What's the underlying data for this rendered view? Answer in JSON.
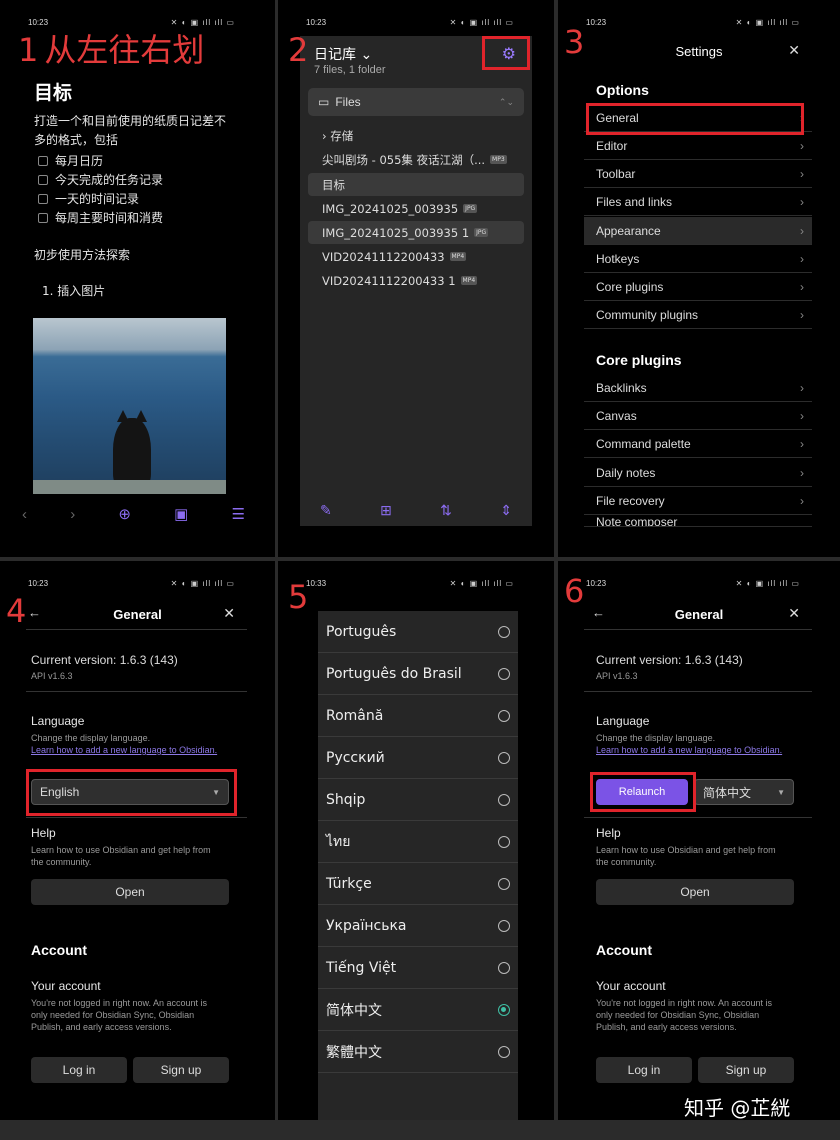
{
  "steps": [
    "1",
    "2",
    "3",
    "4",
    "5",
    "6"
  ],
  "step1_caption": "从左往右划",
  "status": {
    "time_a": "10:23",
    "time_b": "10:33",
    "icons": "✕ ◐ ▣ ıll ıll ▭"
  },
  "panel1": {
    "title": "目标",
    "intro": "打造一个和目前使用的纸质日记差不多的格式，包括",
    "checklist": [
      "每月日历",
      "今天完成的任务记录",
      "一天的时间记录",
      "每周主要时间和消费"
    ],
    "section": "初步使用方法探索",
    "list_item": "1. 插入图片",
    "toolbar": [
      "‹",
      "›",
      "⊕",
      "▣",
      "☰"
    ]
  },
  "panel2": {
    "vault_name": "日记库 ⌄",
    "vault_summary": "7 files, 1 folder",
    "files_label": "Files",
    "rows": [
      {
        "text": "› 存储",
        "tag": ""
      },
      {
        "text": "尖叫剧场 - 055集 夜话江湖（...",
        "tag": "MP3"
      },
      {
        "text": "目标",
        "tag": ""
      },
      {
        "text": "IMG_20241025_003935",
        "tag": "JPG"
      },
      {
        "text": "IMG_20241025_003935 1",
        "tag": "JPG"
      },
      {
        "text": "VID20241112200433",
        "tag": "MP4"
      },
      {
        "text": "VID20241112200433 1",
        "tag": "MP4"
      }
    ],
    "bottom_icons": [
      "✎",
      "⊞",
      "⇅",
      "⇕"
    ]
  },
  "panel3": {
    "title": "Settings",
    "options_header": "Options",
    "options": [
      "General",
      "Editor",
      "Toolbar",
      "Files and links",
      "Appearance",
      "Hotkeys",
      "Core plugins",
      "Community plugins"
    ],
    "core_header": "Core plugins",
    "core": [
      "Backlinks",
      "Canvas",
      "Command palette",
      "Daily notes",
      "File recovery"
    ],
    "cutoff": "Note composer"
  },
  "general": {
    "title": "General",
    "version": "Current version: 1.6.3 (143)",
    "api": "API v1.6.3",
    "language_label": "Language",
    "language_desc": "Change the display language.",
    "language_link": "Learn how to add a new language to Obsidian.",
    "language_value_4": "English",
    "language_value_6": "简体中文",
    "relaunch": "Relaunch",
    "help_label": "Help",
    "help_desc": "Learn how to use Obsidian and get help from the community.",
    "open_button": "Open",
    "account_header": "Account",
    "account_label": "Your account",
    "account_desc": "You're not logged in right now. An account is only needed for Obsidian Sync, Obsidian Publish, and early access versions.",
    "login": "Log in",
    "signup": "Sign up"
  },
  "panel5": {
    "languages": [
      "Português",
      "Português do Brasil",
      "Română",
      "Русский",
      "Shqip",
      "ไทย",
      "Türkçe",
      "Українська",
      "Tiếng Việt",
      "简体中文",
      "繁體中文"
    ],
    "selected_index": 9
  },
  "watermark": "知乎 @芷絖"
}
